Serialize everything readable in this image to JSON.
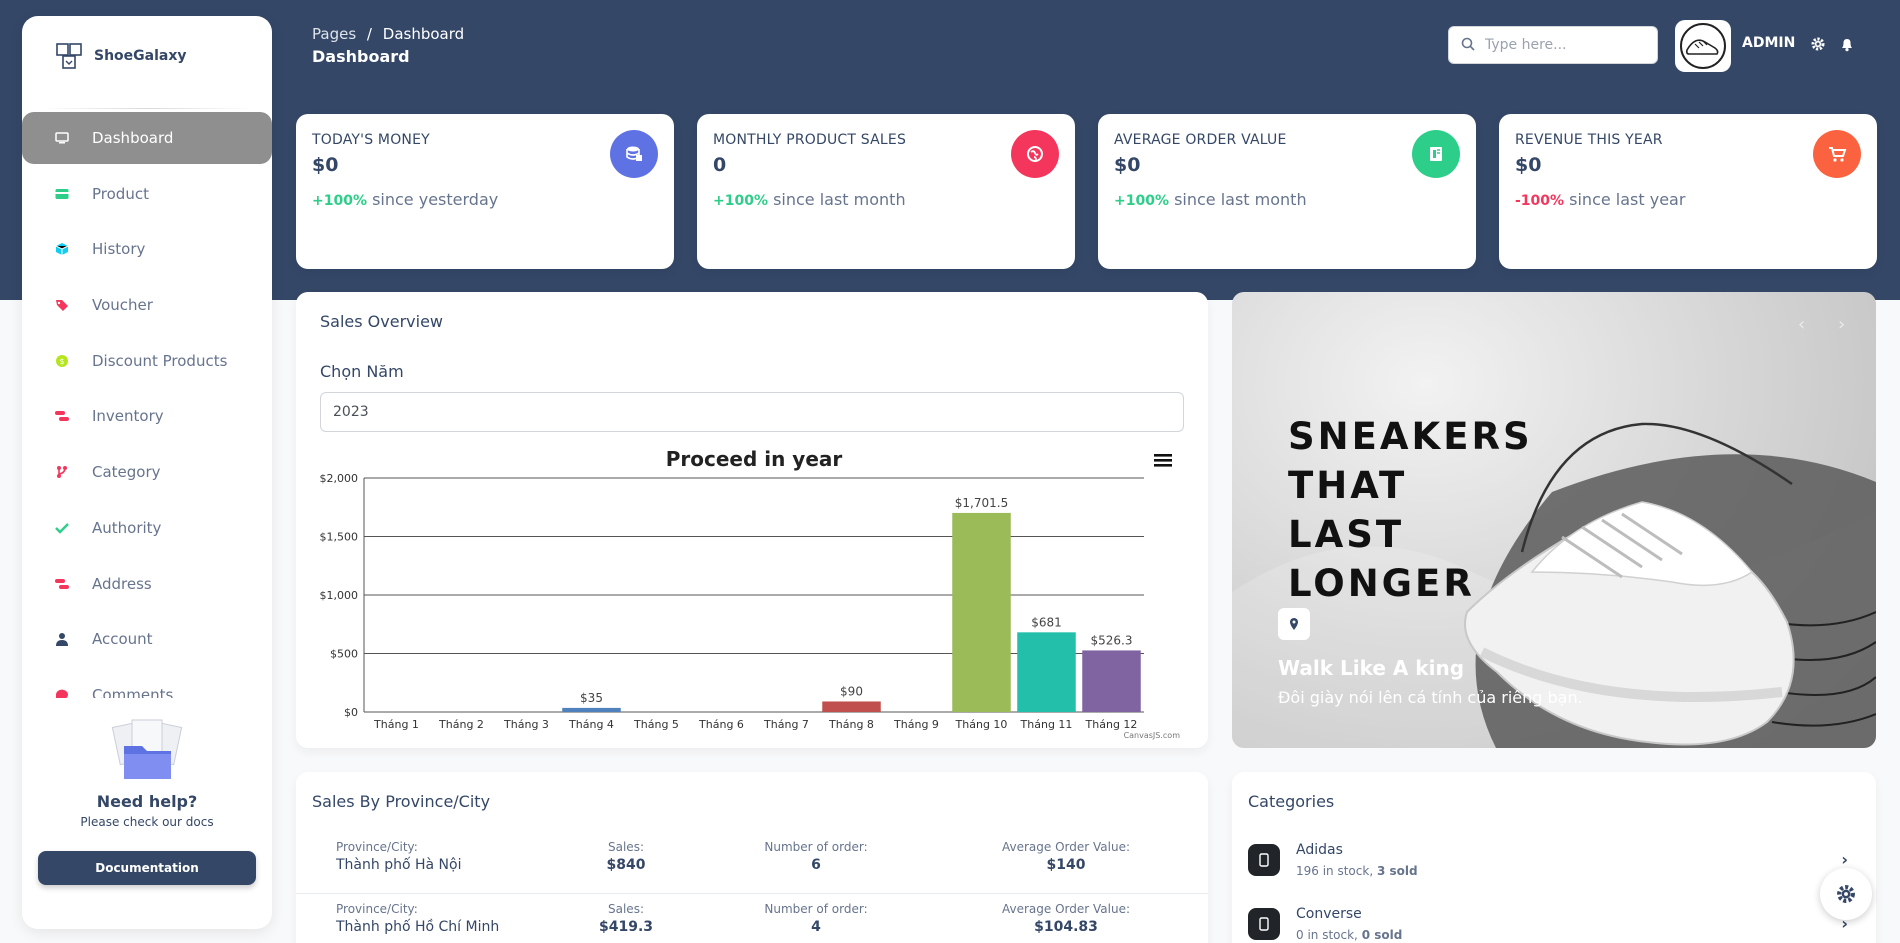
{
  "brand": {
    "name": "ShoeGalaxy"
  },
  "sidebar": {
    "items": [
      {
        "label": "Dashboard",
        "icon": "monitor-icon",
        "color": "#ffffff",
        "active": true
      },
      {
        "label": "Product",
        "icon": "card-icon",
        "color": "#2dce89"
      },
      {
        "label": "History",
        "icon": "box-icon",
        "color": "#11cdef"
      },
      {
        "label": "Voucher",
        "icon": "tag-icon",
        "color": "#f5365c"
      },
      {
        "label": "Discount Products",
        "icon": "coin-icon",
        "color": "#b5e61d"
      },
      {
        "label": "Inventory",
        "icon": "pills-icon",
        "color": "#f5365c"
      },
      {
        "label": "Category",
        "icon": "branch-icon",
        "color": "#f5365c"
      },
      {
        "label": "Authority",
        "icon": "check-icon",
        "color": "#2dce89"
      },
      {
        "label": "Address",
        "icon": "pills-icon",
        "color": "#f5365c"
      },
      {
        "label": "Account",
        "icon": "user-icon",
        "color": "#344767"
      },
      {
        "label": "Comments",
        "icon": "comment-icon",
        "color": "#f5365c"
      }
    ],
    "help": {
      "title": "Need help?",
      "subtitle": "Please check our docs",
      "button": "Documentation"
    }
  },
  "header": {
    "breadcrumb_root": "Pages",
    "breadcrumb_sep": "/",
    "breadcrumb_current": "Dashboard",
    "page_title": "Dashboard",
    "search_placeholder": "Type here...",
    "user_label": "ADMIN"
  },
  "stats": [
    {
      "title": "TODAY'S MONEY",
      "value": "$0",
      "pct": "+100%",
      "pct_color": "#2dce89",
      "since": " since yesterday",
      "icon": "database-icon",
      "icon_bg": "#5e72e4"
    },
    {
      "title": "MONTHLY PRODUCT SALES",
      "value": "0",
      "pct": "+100%",
      "pct_color": "#2dce89",
      "since": " since last month",
      "icon": "globe-icon",
      "icon_bg": "#f5365c"
    },
    {
      "title": "AVERAGE ORDER VALUE",
      "value": "$0",
      "pct": "+100%",
      "pct_color": "#2dce89",
      "since": " since last month",
      "icon": "document-icon",
      "icon_bg": "#2dce89"
    },
    {
      "title": "REVENUE THIS YEAR",
      "value": "$0",
      "pct": "-100%",
      "pct_color": "#f5365c",
      "since": " since last year",
      "icon": "cart-icon",
      "icon_bg": "#fb6340"
    }
  ],
  "sales_overview": {
    "title": "Sales Overview",
    "year_label": "Chọn Năm",
    "year_value": "2023",
    "credit": "CanvasJS.com"
  },
  "chart_data": {
    "type": "bar",
    "title": "Proceed in year",
    "categories": [
      "Tháng 1",
      "Tháng 2",
      "Tháng 3",
      "Tháng 4",
      "Tháng 5",
      "Tháng 6",
      "Tháng 7",
      "Tháng 8",
      "Tháng 9",
      "Tháng 10",
      "Tháng 11",
      "Tháng 12"
    ],
    "values": [
      0,
      0,
      0,
      35,
      0,
      0,
      0,
      90,
      0,
      1701.5,
      681,
      526.3
    ],
    "data_labels": [
      "",
      "",
      "",
      "$35",
      "",
      "",
      "",
      "$90",
      "",
      "$1,701.5",
      "$681",
      "$526.3"
    ],
    "colors": [
      "#4f81bc",
      "#c0504e",
      "#9bbb58",
      "#4f81bc",
      "#8064a1",
      "#4aacc5",
      "#f79647",
      "#c0504e",
      "#7f6084",
      "#9bbb58",
      "#23bfaa",
      "#8064a1"
    ],
    "yticks": [
      "$0",
      "$500",
      "$1,000",
      "$1,500",
      "$2,000"
    ],
    "ytick_values": [
      0,
      500,
      1000,
      1500,
      2000
    ],
    "ylim": [
      0,
      2000
    ],
    "grid": true
  },
  "banner": {
    "headline": [
      "SNEAKERS",
      "THAT",
      "LAST",
      "LONGER"
    ],
    "caption": "Walk Like A king",
    "subcaption": "Đôi giày nói lên cá tính của riêng bạn.",
    "prev": "‹",
    "next": "›"
  },
  "province": {
    "title": "Sales By Province/City",
    "labels": {
      "city": "Province/City:",
      "sales": "Sales:",
      "orders": "Number of order:",
      "avg": "Average Order Value:"
    },
    "rows": [
      {
        "city": "Thành phố Hà Nội",
        "sales": "$840",
        "orders": "6",
        "avg": "$140"
      },
      {
        "city": "Thành phố Hồ Chí Minh",
        "sales": "$419.3",
        "orders": "4",
        "avg": "$104.83"
      }
    ]
  },
  "categories": {
    "title": "Categories",
    "items": [
      {
        "name": "Adidas",
        "stock_pre": "196 in stock, ",
        "sold": "3 sold"
      },
      {
        "name": "Converse",
        "stock_pre": "0 in stock, ",
        "sold": "0 sold"
      }
    ]
  }
}
